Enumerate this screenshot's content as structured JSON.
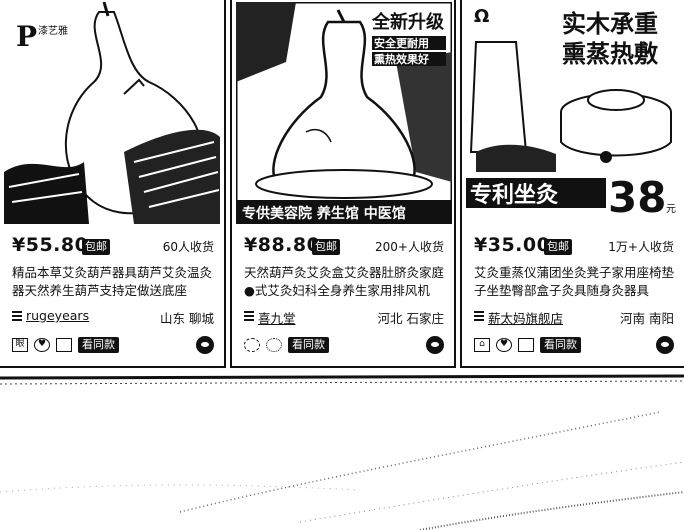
{
  "products": [
    {
      "price": "¥55.80",
      "post_badge": "包邮",
      "sales": "60人收货",
      "title": "精品本草艾灸葫芦器具葫芦艾灸温灸器天然养生葫芦支持定做送底座",
      "shop": "rugeyears",
      "location": "山东 聊城",
      "same_badge": "看同款",
      "image_text": "漆艺雅",
      "tag_icons": [
        "service-icon",
        "heart-icon",
        "checkbox-icon"
      ]
    },
    {
      "price": "¥88.80",
      "post_badge": "包邮",
      "sales": "200+人收货",
      "title": "天然葫芦灸艾灸盒艾灸器肚脐灸家庭●式艾灸妇科全身养生家用排风机",
      "shop": "喜九堂",
      "location": "河北 石家庄",
      "same_badge": "看同款",
      "image_text": {
        "headline": "全新升级",
        "sub1": "安全更耐用",
        "sub2": "熏热效果好",
        "bottom": "专供美容院 养生馆 中医馆"
      },
      "tag_icons": [
        "radio-icon",
        "circle-icon"
      ]
    },
    {
      "price": "¥35.00",
      "post_badge": "包邮",
      "sales": "1万+人收货",
      "title": "艾灸重蒸仪蒲团坐灸凳子家用座椅垫子坐垫臀部盒子灸具随身灸器具",
      "shop": "薪太妈旗舰店",
      "location": "河南 南阳",
      "same_badge": "看同款",
      "image_text": {
        "headline1": "实木承重",
        "headline2": "熏蒸热敷",
        "banner": "专利坐灸",
        "big_number": "38",
        "unit": "元",
        "logo": "Ω"
      },
      "tag_icons": [
        "cart-icon",
        "heart-icon",
        "checkbox-icon"
      ]
    }
  ]
}
